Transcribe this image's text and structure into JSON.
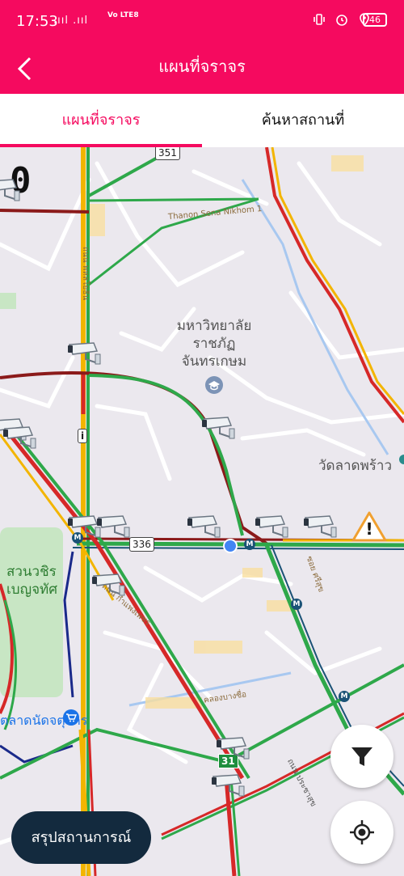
{
  "status_bar": {
    "time": "17:53",
    "network": ".ııl .ııl",
    "volte": "Vo LTE8",
    "battery": "46",
    "icons": [
      "wifi-icon",
      "vibrate-icon",
      "alarm-icon",
      "location-icon"
    ]
  },
  "app_bar": {
    "title": "แผนที่จราจร",
    "back_icon": "chevron-left-icon"
  },
  "tabs": [
    {
      "label": "แผนที่จราจร",
      "active": true
    },
    {
      "label": "ค้นหาสถานที่",
      "active": false
    }
  ],
  "map": {
    "speed_display": "0",
    "road_shields": {
      "r351": "351",
      "r336": "336",
      "r31": "31",
      "ri": "i"
    },
    "labels": {
      "university": "มหาวิทยาลัย\nราชภัฏ\nจันทรเกษม",
      "temple": "วัดลาดพร้าว",
      "park": "สวนวชิร\nเบญจทัศ",
      "market": "ตลาดนัดจตุจักร",
      "road_sena": "Thanon Sena Nikhom 1",
      "road_vertical": "ถนน พหลโยธิน",
      "road_soi": "ซอย ศรีสุข",
      "road_diag": "ถนน กำแพงเพชร",
      "canal": "คลองบางซื่อ",
      "road_pracha": "ถนน ประชาสุข"
    },
    "metro_symbol": "M",
    "colors": {
      "green": "#2ea84a",
      "yellow": "#f3b500",
      "red": "#d62828",
      "darkred": "#8b1a1a",
      "metro_blue": "#1a5276"
    }
  },
  "buttons": {
    "filter_icon": "filter-icon",
    "locate_icon": "crosshair-icon",
    "summary_label": "สรุปสถานการณ์"
  },
  "markers": {
    "camera_icon": "cctv-camera-icon",
    "warning_icon": "warning-triangle-icon",
    "warning_symbol": "!"
  }
}
